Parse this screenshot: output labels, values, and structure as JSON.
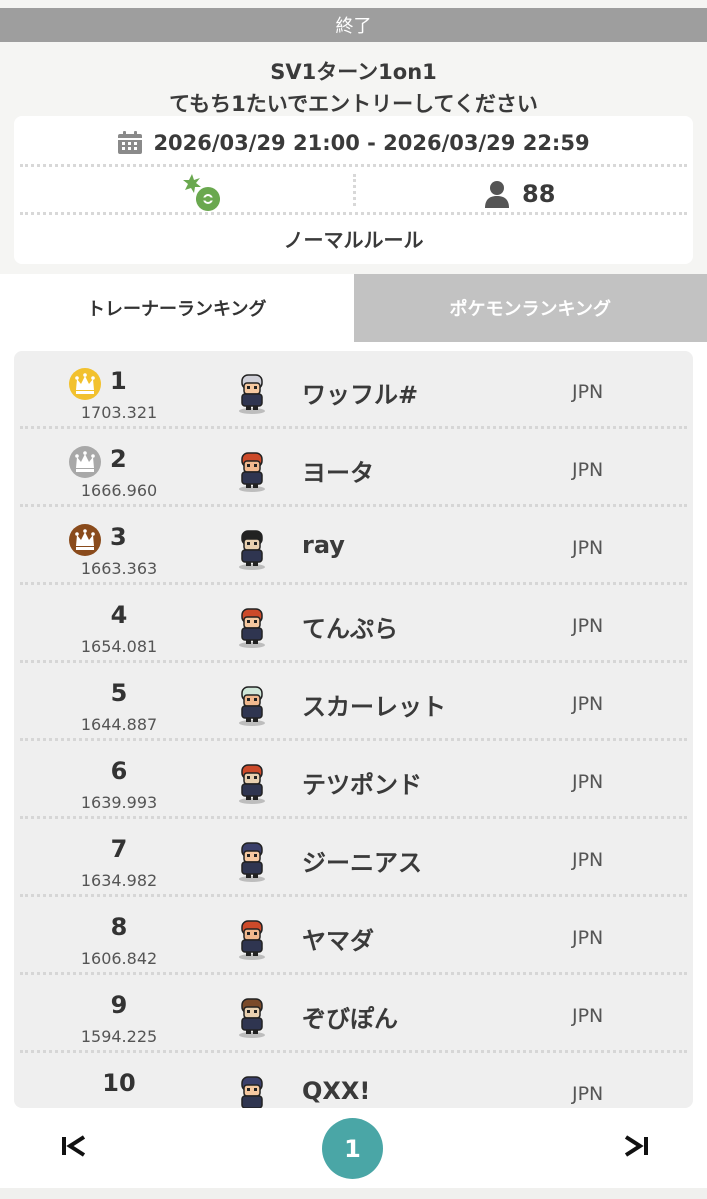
{
  "status_label": "終了",
  "event": {
    "title": "SV1ターン1on1",
    "subtitle": "てもち1たいでエントリーしてください",
    "date_range": "2026/03/29 21:00 - 2026/03/29 22:59",
    "participants": "88",
    "rule": "ノーマルルール",
    "regulation_icon": "green-star-pokeball-icon"
  },
  "tabs": [
    {
      "label": "トレーナーランキング",
      "active": true
    },
    {
      "label": "ポケモンランキング",
      "active": false
    }
  ],
  "rankings": [
    {
      "rank": "1",
      "rating": "1703.321",
      "name": "ワッフル#",
      "country": "JPN",
      "crown": "gold"
    },
    {
      "rank": "2",
      "rating": "1666.960",
      "name": "ヨータ",
      "country": "JPN",
      "crown": "silver"
    },
    {
      "rank": "3",
      "rating": "1663.363",
      "name": "ray",
      "country": "JPN",
      "crown": "bronze"
    },
    {
      "rank": "4",
      "rating": "1654.081",
      "name": "てんぷら",
      "country": "JPN"
    },
    {
      "rank": "5",
      "rating": "1644.887",
      "name": "スカーレット",
      "country": "JPN"
    },
    {
      "rank": "6",
      "rating": "1639.993",
      "name": "テツポンド",
      "country": "JPN"
    },
    {
      "rank": "7",
      "rating": "1634.982",
      "name": "ジーニアス",
      "country": "JPN"
    },
    {
      "rank": "8",
      "rating": "1606.842",
      "name": "ヤマダ",
      "country": "JPN"
    },
    {
      "rank": "9",
      "rating": "1594.225",
      "name": "ぞびぽん",
      "country": "JPN"
    },
    {
      "rank": "10",
      "rating": "",
      "name": "QXX!",
      "country": "JPN"
    }
  ],
  "pagination": {
    "current": "1",
    "first_icon": "first-page-icon",
    "last_icon": "last-page-icon"
  },
  "colors": {
    "status_bar": "#9e9e9e",
    "tab_inactive": "#c2c2c2",
    "page_current": "#4aa6a6",
    "crown_gold": "#f2c12e",
    "crown_silver": "#a8a8a8",
    "crown_bronze": "#8a4b1c",
    "regulation_green": "#6aa84f"
  }
}
